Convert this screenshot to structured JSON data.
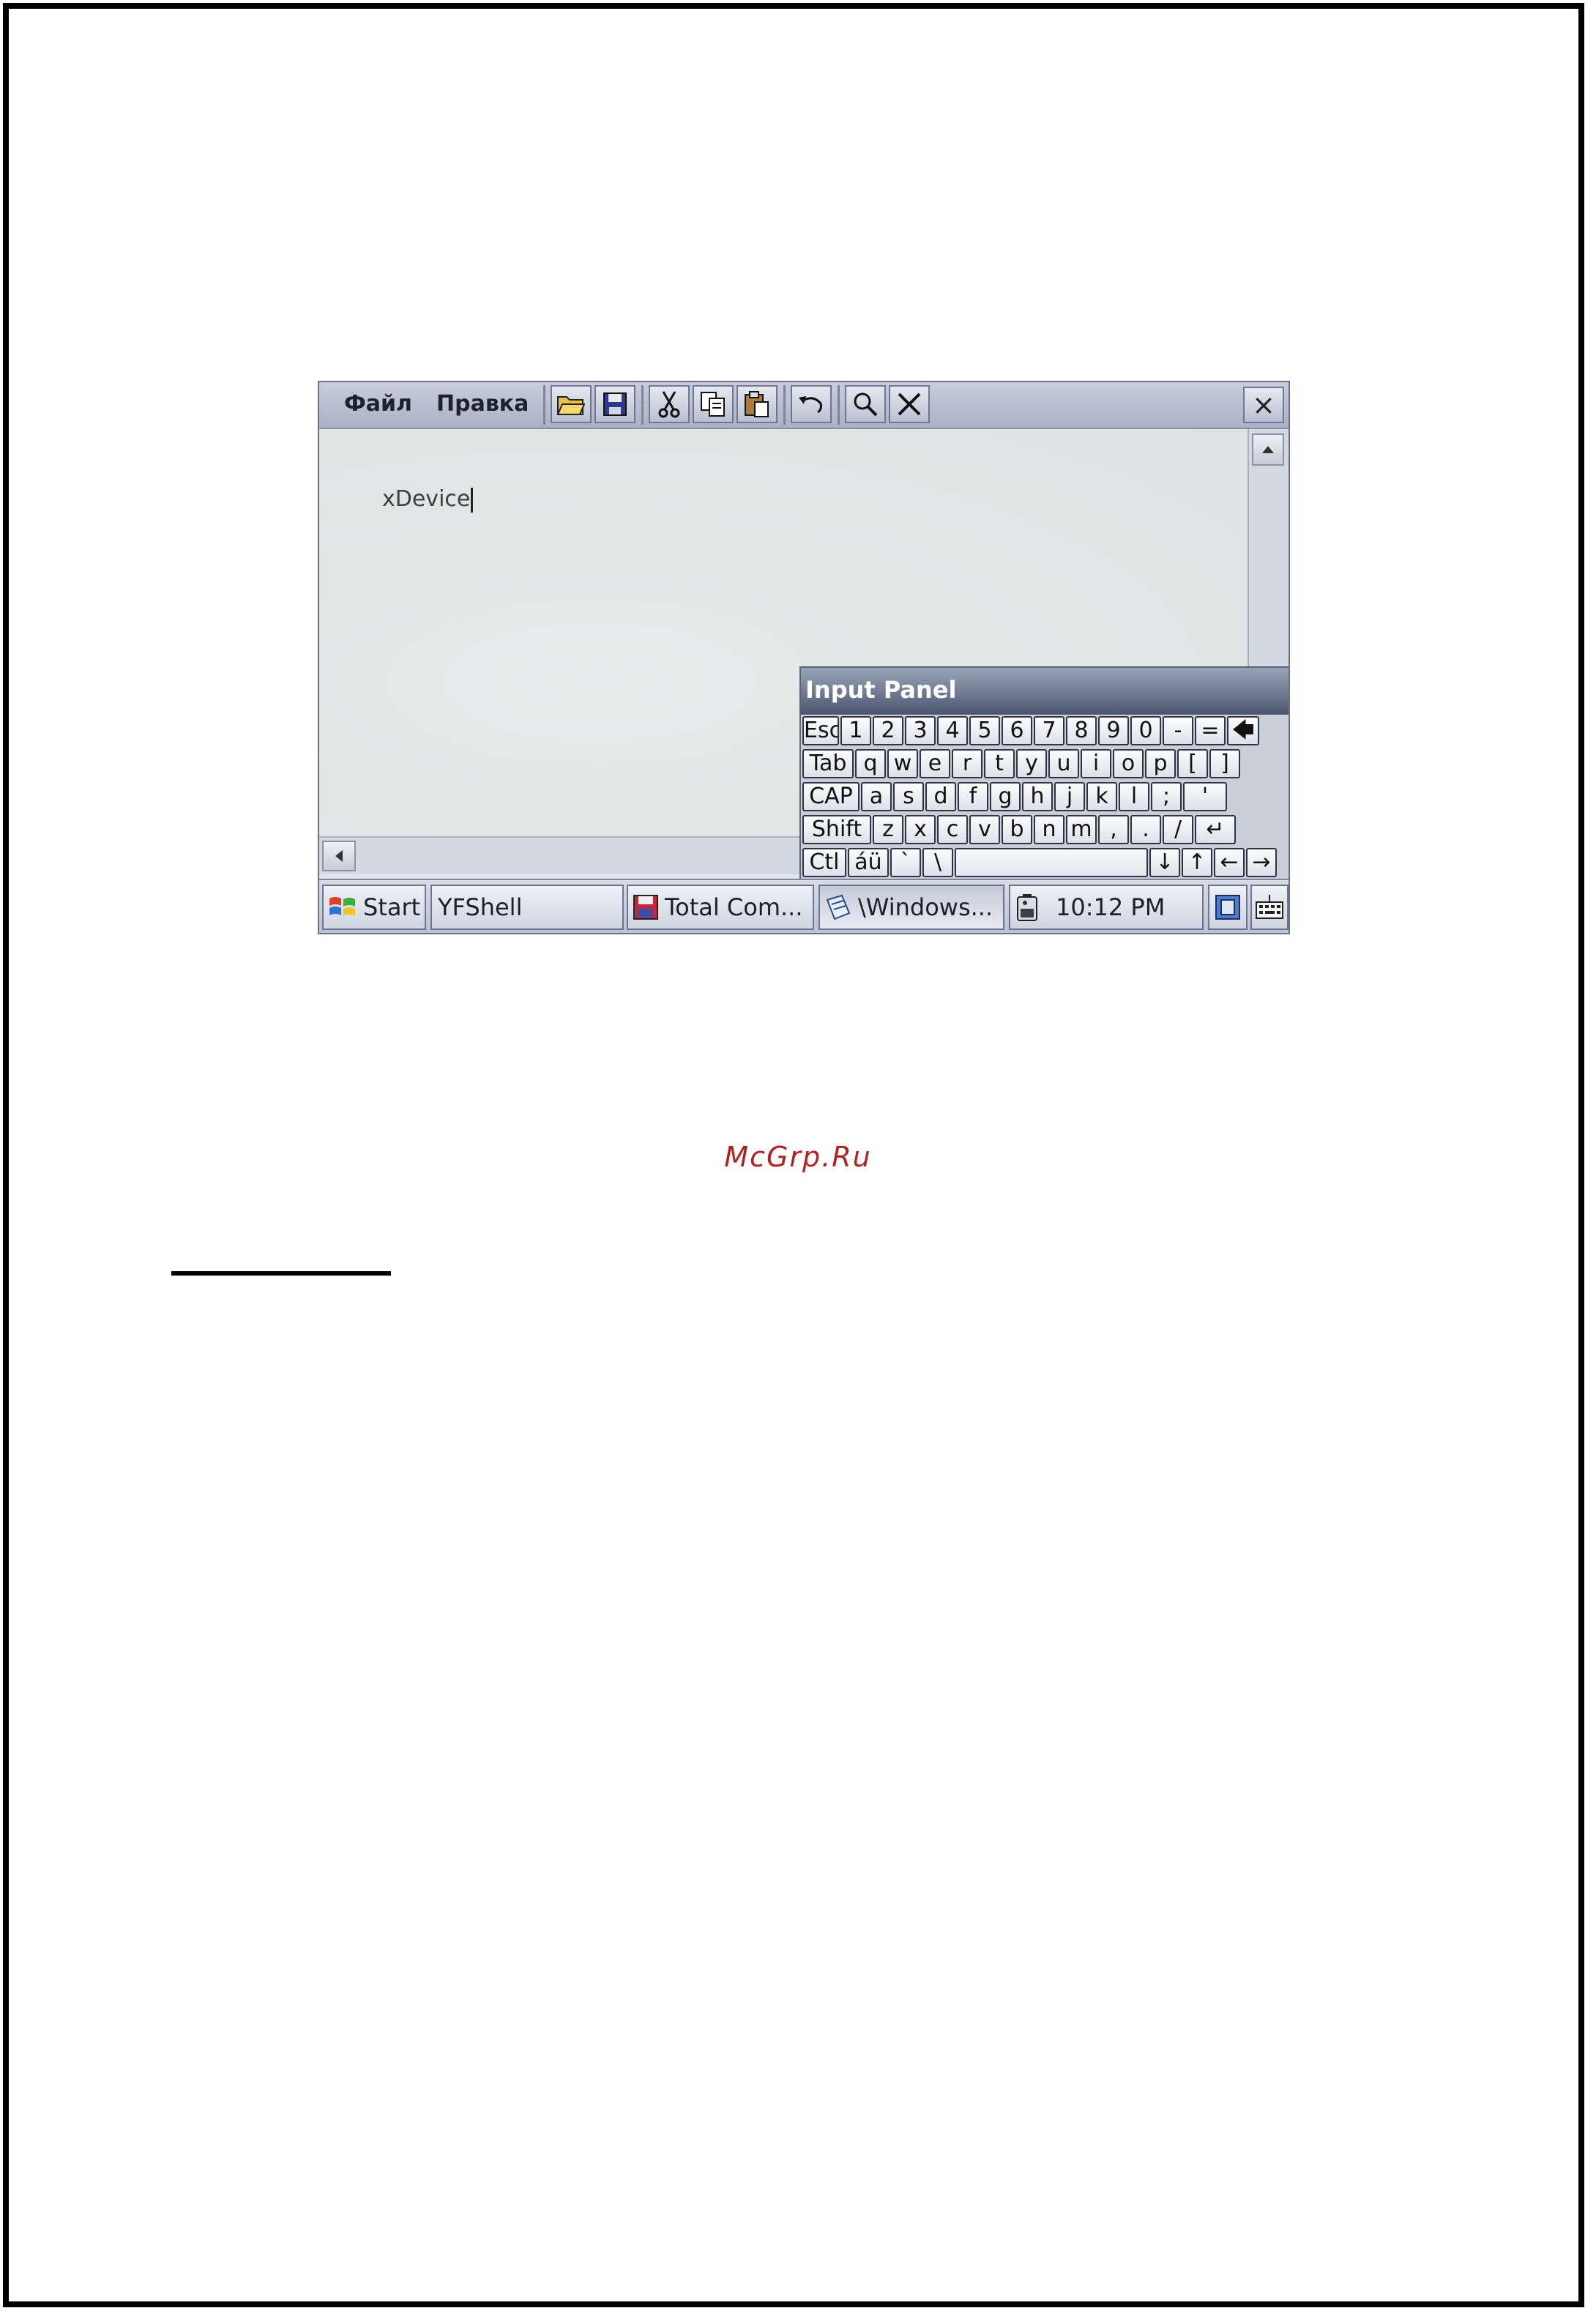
{
  "menu": {
    "file": "Файл",
    "edit": "Правка"
  },
  "toolbar": {
    "buttons": [
      "open-icon",
      "save-icon",
      "cut-icon",
      "copy-icon",
      "paste-icon",
      "undo-icon",
      "find-icon",
      "close-doc-icon"
    ],
    "close": "×"
  },
  "editor": {
    "text": "xDevice"
  },
  "input_panel": {
    "title": "Input Panel",
    "rows": [
      [
        "Esc",
        "1",
        "2",
        "3",
        "4",
        "5",
        "6",
        "7",
        "8",
        "9",
        "0",
        "-",
        "=",
        "🡄"
      ],
      [
        "Tab",
        "q",
        "w",
        "e",
        "r",
        "t",
        "y",
        "u",
        "i",
        "o",
        "p",
        "[",
        "]"
      ],
      [
        "CAP",
        "a",
        "s",
        "d",
        "f",
        "g",
        "h",
        "j",
        "k",
        "l",
        ";",
        "'"
      ],
      [
        "Shift",
        "z",
        "x",
        "c",
        "v",
        "b",
        "n",
        "m",
        ",",
        ".",
        "/",
        "↵"
      ],
      [
        "Ctl",
        "áü",
        "`",
        "\\",
        "",
        "↓",
        "↑",
        "←",
        "→"
      ]
    ]
  },
  "taskbar": {
    "start": "Start",
    "tasks": [
      "YFShell",
      "Total Com...",
      "\\Windows..."
    ],
    "clock": "10:12 PM"
  },
  "watermark": "McGrp.Ru"
}
